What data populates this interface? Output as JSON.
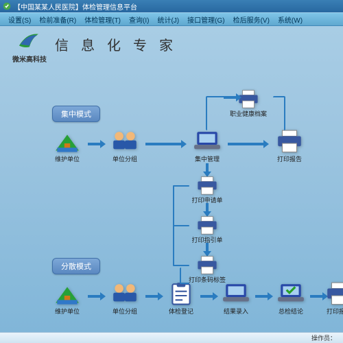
{
  "window": {
    "title": "【中国某某人民医院】体检管理信息平台"
  },
  "menu": [
    {
      "label": "设置(S)"
    },
    {
      "label": "检前准备(R)"
    },
    {
      "label": "体检管理(T)"
    },
    {
      "label": "查询(I)"
    },
    {
      "label": "统计(J)"
    },
    {
      "label": "接口管理(G)"
    },
    {
      "label": "检后服务(V)"
    },
    {
      "label": "系统(W)"
    }
  ],
  "brand": {
    "caption": "微米高科技",
    "slogan": "信息化专家"
  },
  "modes": {
    "centralized": "集中模式",
    "distributed": "分散模式"
  },
  "nodes": {
    "c_unit": "维护单位",
    "c_group": "单位分组",
    "c_center": "集中管理",
    "c_print": "打印报告",
    "occ_health": "职业健康档案",
    "p_apply": "打印申请单",
    "p_guide": "打印指引单",
    "p_barcode": "打印条码标签",
    "d_unit": "维护单位",
    "d_group": "单位分组",
    "d_reg": "体检登记",
    "d_result": "结果录入",
    "d_conc": "总检结论",
    "d_print": "打印报告"
  },
  "status": {
    "operator_label": "操作员："
  },
  "colors": {
    "arrow": "#2a7cc0",
    "mode_bg": "#5a88c0"
  }
}
